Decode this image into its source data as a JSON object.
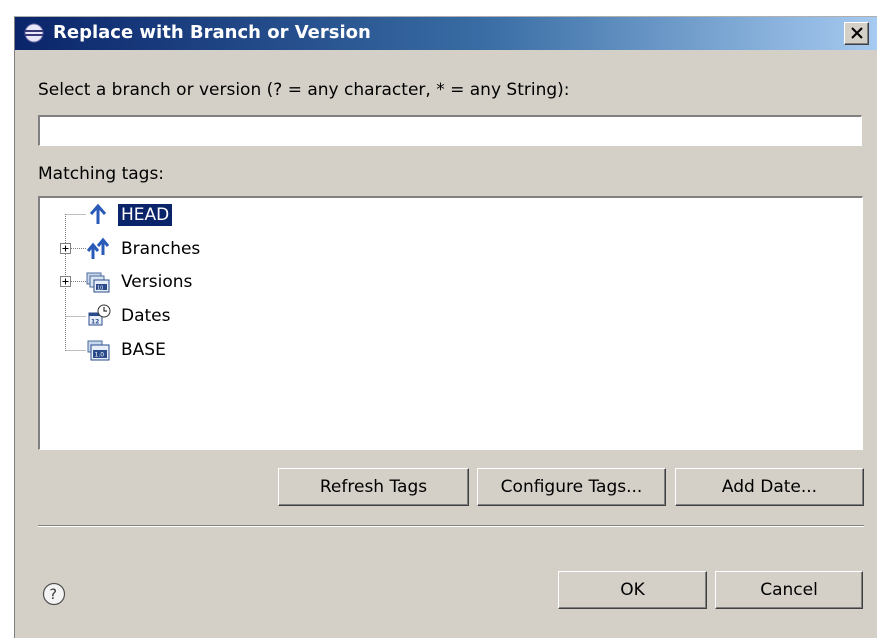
{
  "window": {
    "title": "Replace with Branch or Version",
    "close_label": "×"
  },
  "filter": {
    "prompt": "Select a branch or version (? = any character, * = any String):",
    "value": "",
    "placeholder": ""
  },
  "tags": {
    "label": "Matching tags:",
    "items": [
      {
        "label": "HEAD",
        "icon": "head-arrow-icon",
        "expandable": false,
        "selected": true
      },
      {
        "label": "Branches",
        "icon": "branches-icon",
        "expandable": true,
        "selected": false
      },
      {
        "label": "Versions",
        "icon": "versions-icon",
        "expandable": true,
        "selected": false
      },
      {
        "label": "Dates",
        "icon": "dates-icon",
        "expandable": false,
        "selected": false
      },
      {
        "label": "BASE",
        "icon": "base-version-icon",
        "expandable": false,
        "selected": false
      }
    ]
  },
  "buttons": {
    "refresh": "Refresh Tags",
    "configure": "Configure Tags...",
    "add_date": "Add Date...",
    "ok": "OK",
    "cancel": "Cancel"
  },
  "colors": {
    "title_start": "#0a246a",
    "title_end": "#a6caf0",
    "dialog_bg": "#d4d0c8",
    "selection": "#0a246a",
    "icon_blue": "#2a5ab8"
  },
  "help": {
    "icon": "help-icon"
  }
}
